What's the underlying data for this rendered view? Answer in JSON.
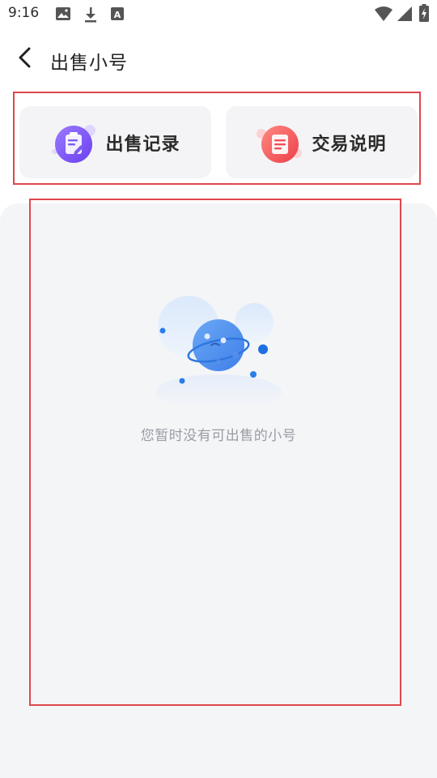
{
  "status_bar": {
    "time": "9:16",
    "icons": [
      "image-icon",
      "download-icon",
      "text-a-icon",
      "wifi-icon",
      "signal-icon",
      "battery-charging-icon"
    ]
  },
  "nav": {
    "title": "出售小号",
    "back_icon": "chevron-left-icon"
  },
  "actions": [
    {
      "label": "出售记录",
      "icon": "sale-record-icon",
      "accent": "#7b5cf0"
    },
    {
      "label": "交易说明",
      "icon": "trade-info-icon",
      "accent": "#f0505a"
    }
  ],
  "empty_state": {
    "message": "您暂时没有可出售的小号",
    "illustration": "sad-planet-icon"
  },
  "colors": {
    "highlight_frame": "#e0474c",
    "panel_bg": "#f4f5f7",
    "card_bg": "#f4f4f6"
  }
}
